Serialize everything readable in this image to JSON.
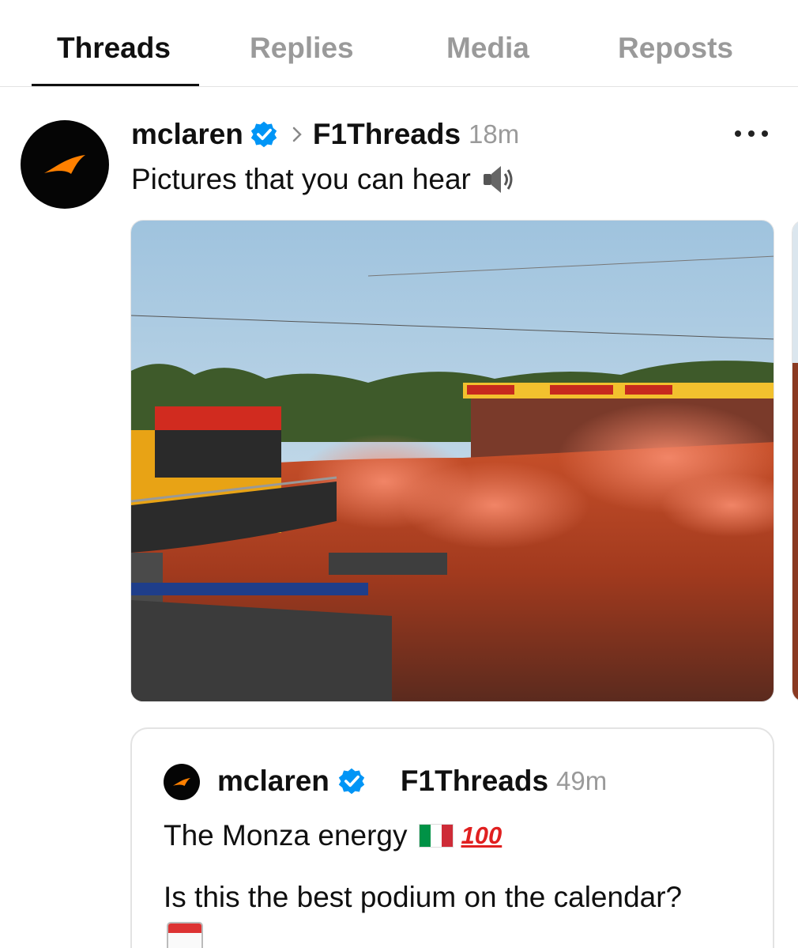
{
  "tabs": [
    {
      "label": "Threads",
      "active": true
    },
    {
      "label": "Replies",
      "active": false
    },
    {
      "label": "Media",
      "active": false
    },
    {
      "label": "Reposts",
      "active": false
    }
  ],
  "post": {
    "author": "mclaren",
    "verified": true,
    "reply_to": "F1Threads",
    "time": "18m",
    "text": "Pictures that you can hear",
    "text_emoji": "speaker-icon",
    "image_description_icon": "podium-crowd-photo",
    "accent_color": "#ff8000"
  },
  "quote": {
    "author": "mclaren",
    "verified": true,
    "thread": "F1Threads",
    "time": "49m",
    "line1": "The Monza energy",
    "hundred": "100",
    "line2": "Is this the best podium on the calendar?"
  },
  "colors": {
    "verified_blue": "#0095f6",
    "muted": "#9a9a9a",
    "text": "#101010",
    "flag_green": "#009246",
    "flag_white": "#ffffff",
    "flag_red": "#ce2b37"
  }
}
